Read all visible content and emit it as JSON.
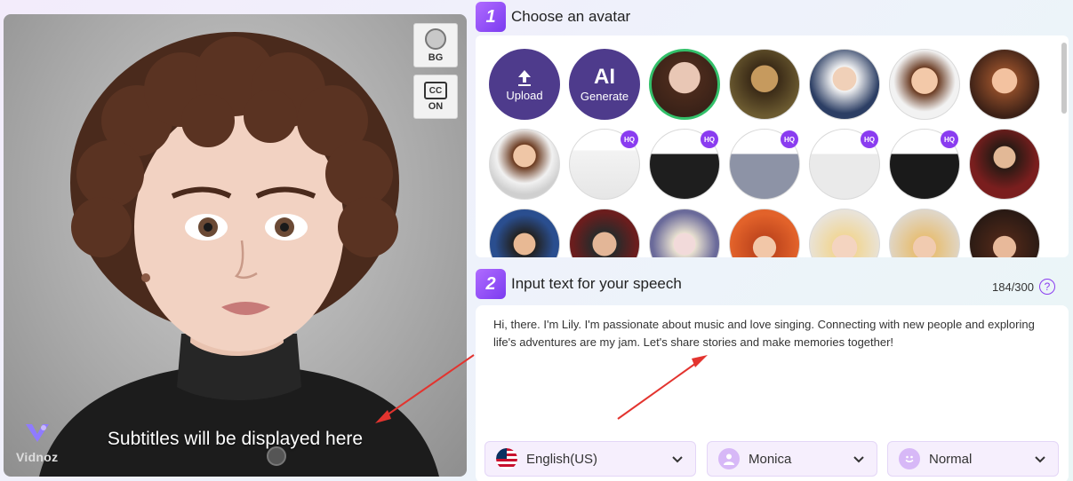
{
  "preview": {
    "bg_label": "BG",
    "cc_label": "CC",
    "cc_state": "ON",
    "subtitle": "Subtitles will be displayed here",
    "logo_text": "Vidnoz"
  },
  "step1": {
    "number": "1",
    "title": "Choose an avatar"
  },
  "avatar_actions": {
    "upload_label": "Upload",
    "ai_label": "AI",
    "generate_label": "Generate"
  },
  "hq_badge": "HQ",
  "step2": {
    "number": "2",
    "title": "Input text for your speech"
  },
  "char_counter": "184/300",
  "help_glyph": "?",
  "speech_text": "Hi, there. I'm Lily. I'm passionate about music and love singing. Connecting with new people and exploring life's adventures are my jam. Let's share stories and make memories together!",
  "language_select": {
    "value": "English(US)",
    "icon": "us-flag-icon"
  },
  "voice_select": {
    "value": "Monica",
    "icon": "person-icon"
  },
  "tone_select": {
    "value": "Normal",
    "icon": "smiley-icon"
  },
  "colors": {
    "accent": "#8a3cf0",
    "action_bg": "#4e3b8c",
    "selected_ring": "#33c06a"
  }
}
